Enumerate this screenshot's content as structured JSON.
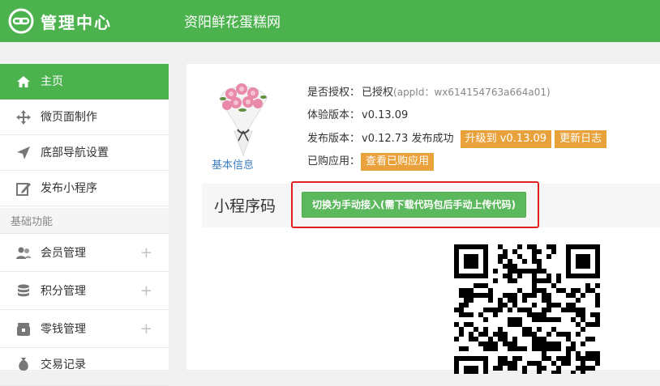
{
  "header": {
    "app_title": "管理中心",
    "shop_name": "资阳鲜花蛋糕网",
    "brand_color": "#4bb24d",
    "logo_icon": "link-icon"
  },
  "sidebar": {
    "items": [
      {
        "label": "主页",
        "icon": "home-icon",
        "active": true
      },
      {
        "label": "微页面制作",
        "icon": "move-icon"
      },
      {
        "label": "底部导航设置",
        "icon": "navigation-arrow-icon"
      },
      {
        "label": "发布小程序",
        "icon": "edit-icon"
      }
    ],
    "section_title": "基础功能",
    "section_items": [
      {
        "label": "会员管理",
        "icon": "users-icon",
        "expand": "+"
      },
      {
        "label": "积分管理",
        "icon": "coins-icon",
        "expand": "+"
      },
      {
        "label": "零钱管理",
        "icon": "wallet-icon",
        "expand": "+"
      },
      {
        "label": "交易记录",
        "icon": "money-bag-icon"
      }
    ]
  },
  "main": {
    "basic_info_link": "基本信息",
    "auth": {
      "label": "是否授权：",
      "value": "已授权",
      "appid": "(appId：wx614154763a664a01)"
    },
    "trial_version": {
      "label": "体验版本：",
      "value": "v0.13.09"
    },
    "release_version": {
      "label": "发布版本：",
      "value": "v0.12.73 发布成功",
      "upgrade_button": "升级到 v0.13.09",
      "changelog_button": "更新日志"
    },
    "purchased": {
      "label": "已购应用：",
      "button": "查看已购应用"
    },
    "code_section": {
      "title": "小程序码",
      "switch_button": "切换为手动接入(需下载代码包后手动上传代码)"
    }
  },
  "colors": {
    "accent_green": "#4bb24d",
    "tag_orange": "#e9a23b",
    "highlight_red": "#e02020",
    "link_blue": "#3d7fc1"
  }
}
